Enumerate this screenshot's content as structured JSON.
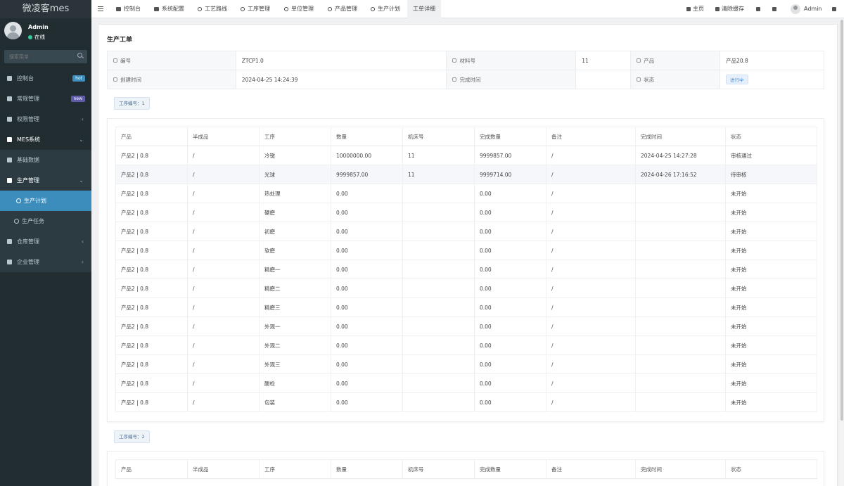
{
  "app": {
    "logo": "微凌客mes"
  },
  "user": {
    "name": "Admin",
    "status": "在线"
  },
  "search": {
    "placeholder": "搜索菜单"
  },
  "sidebar": {
    "items": [
      {
        "label": "控制台",
        "badge": "hot"
      },
      {
        "label": "常规管理",
        "badge": "new"
      },
      {
        "label": "权限管理"
      },
      {
        "label": "MES系统"
      },
      {
        "label": "基础数据"
      },
      {
        "label": "生产管理"
      },
      {
        "label": "生产计划"
      },
      {
        "label": "生产任务"
      },
      {
        "label": "仓库管理"
      },
      {
        "label": "企业管理"
      }
    ],
    "badge_colors": {
      "hot": "#3c8dbc",
      "new": "#605ca8"
    },
    "active_color": "#3c8dbc"
  },
  "topnav": {
    "tabs": [
      "控制台",
      "系统配置",
      "工艺路线",
      "工序管理",
      "单位管理",
      "产品管理",
      "生产计划",
      "工单详细"
    ],
    "home": "主页",
    "clear_cache": "清除缓存",
    "admin": "Admin"
  },
  "page": {
    "title": "生产工单",
    "info": {
      "code_label": "编号",
      "code_value": "ZTCP1.0",
      "material_label": "材料号",
      "material_value": "11",
      "product_label": "产品",
      "product_value": "产品20.8",
      "created_label": "创建时间",
      "created_value": "2024-04-25 14:24:39",
      "finished_label": "完成时间",
      "finished_value": "",
      "status_label": "状态",
      "status_value": "进行中"
    },
    "group1": "工序编号：1",
    "group2": "工序编号：2"
  },
  "table": {
    "headers": [
      "产品",
      "半成品",
      "工序",
      "数量",
      "机床号",
      "完成数量",
      "备注",
      "完成时间",
      "状态"
    ],
    "rows": [
      [
        "产品2 | 0.8",
        "/",
        "冷镦",
        "10000000.00",
        "11",
        "9999857.00",
        "/",
        "2024-04-25 14:27:28",
        "审核通过"
      ],
      [
        "产品2 | 0.8",
        "/",
        "光球",
        "9999857.00",
        "11",
        "9999714.00",
        "/",
        "2024-04-26 17:16:52",
        "待审核"
      ],
      [
        "产品2 | 0.8",
        "/",
        "热处理",
        "0.00",
        "",
        "0.00",
        "/",
        "",
        "未开始"
      ],
      [
        "产品2 | 0.8",
        "/",
        "硬磨",
        "0.00",
        "",
        "0.00",
        "/",
        "",
        "未开始"
      ],
      [
        "产品2 | 0.8",
        "/",
        "初磨",
        "0.00",
        "",
        "0.00",
        "/",
        "",
        "未开始"
      ],
      [
        "产品2 | 0.8",
        "/",
        "软磨",
        "0.00",
        "",
        "0.00",
        "/",
        "",
        "未开始"
      ],
      [
        "产品2 | 0.8",
        "/",
        "精磨一",
        "0.00",
        "",
        "0.00",
        "/",
        "",
        "未开始"
      ],
      [
        "产品2 | 0.8",
        "/",
        "精磨二",
        "0.00",
        "",
        "0.00",
        "/",
        "",
        "未开始"
      ],
      [
        "产品2 | 0.8",
        "/",
        "精磨三",
        "0.00",
        "",
        "0.00",
        "/",
        "",
        "未开始"
      ],
      [
        "产品2 | 0.8",
        "/",
        "外观一",
        "0.00",
        "",
        "0.00",
        "/",
        "",
        "未开始"
      ],
      [
        "产品2 | 0.8",
        "/",
        "外观二",
        "0.00",
        "",
        "0.00",
        "/",
        "",
        "未开始"
      ],
      [
        "产品2 | 0.8",
        "/",
        "外观三",
        "0.00",
        "",
        "0.00",
        "/",
        "",
        "未开始"
      ],
      [
        "产品2 | 0.8",
        "/",
        "酸检",
        "0.00",
        "",
        "0.00",
        "/",
        "",
        "未开始"
      ],
      [
        "产品2 | 0.8",
        "/",
        "包装",
        "0.00",
        "",
        "0.00",
        "/",
        "",
        "未开始"
      ]
    ]
  }
}
